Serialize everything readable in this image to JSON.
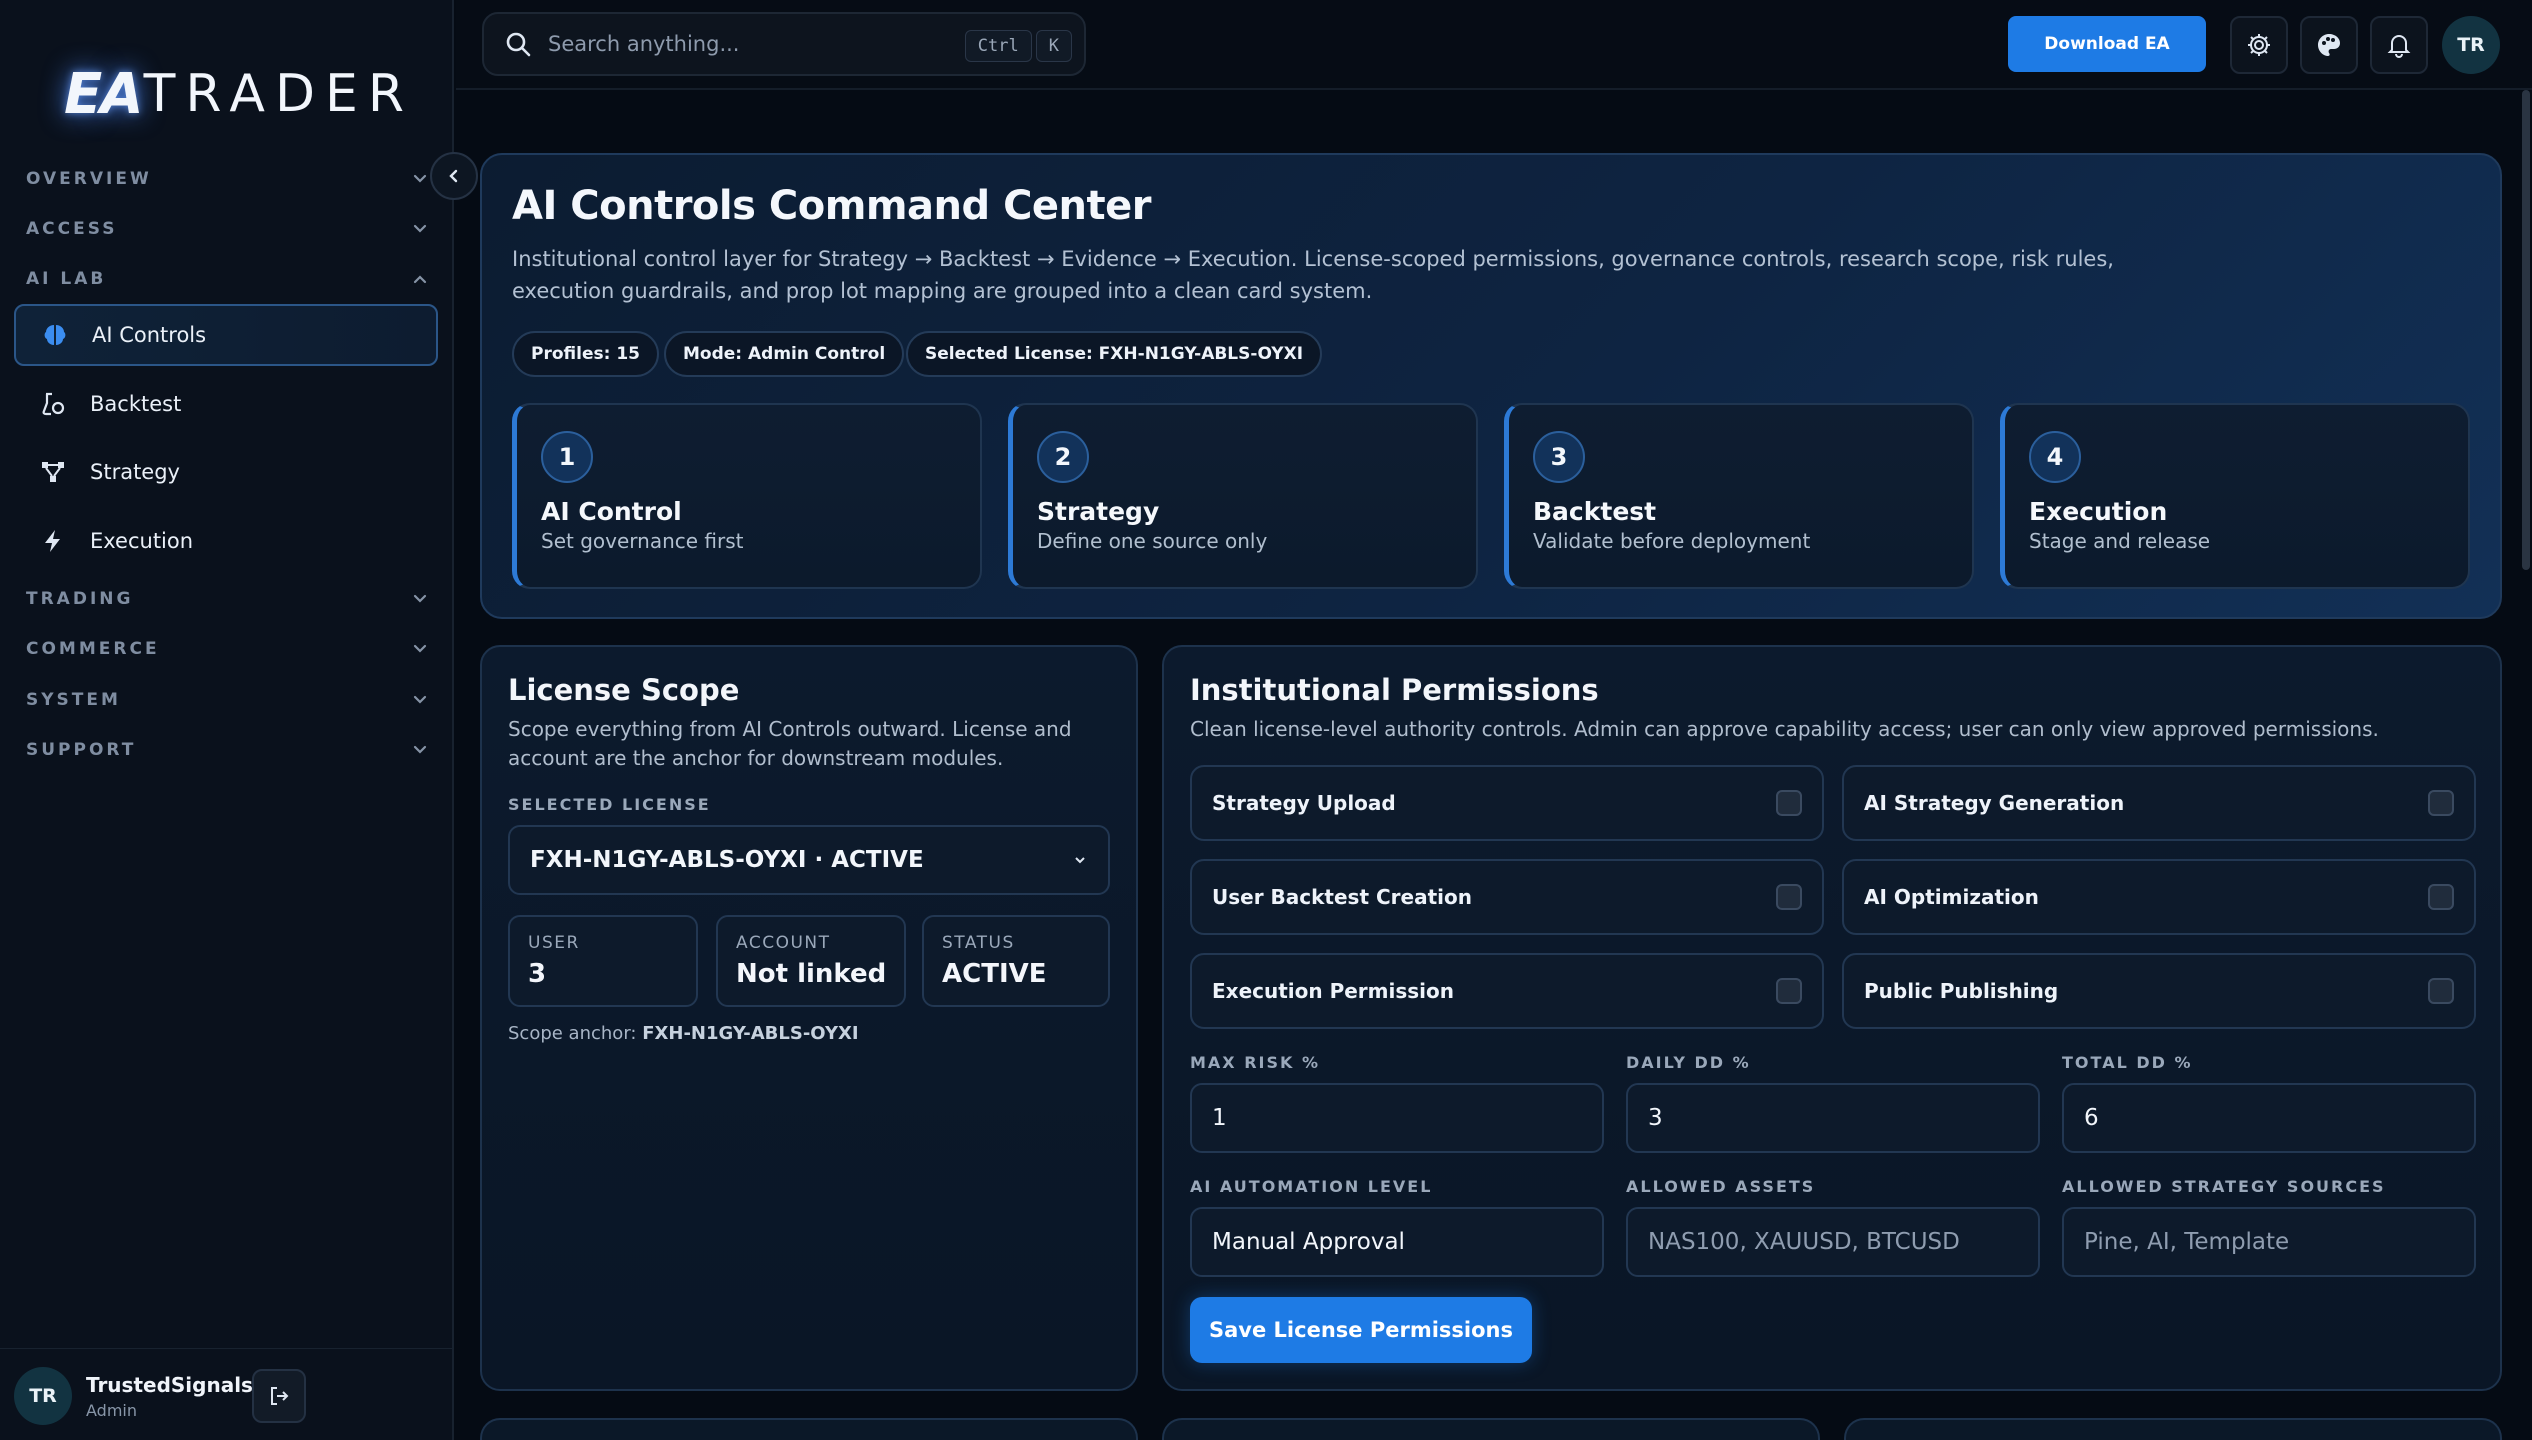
{
  "brand": {
    "logo_ea": "EA",
    "logo_trader": "TRADER"
  },
  "search": {
    "placeholder": "Search anything...",
    "shortcut_ctrl": "Ctrl",
    "shortcut_key": "K"
  },
  "topbar": {
    "download_label": "Download EA",
    "user_initials": "TR"
  },
  "sidebar": {
    "sections": [
      {
        "label": "OVERVIEW"
      },
      {
        "label": "ACCESS"
      },
      {
        "label": "AI LAB"
      },
      {
        "label": "TRADING"
      },
      {
        "label": "COMMERCE"
      },
      {
        "label": "SYSTEM"
      },
      {
        "label": "SUPPORT"
      }
    ],
    "items": [
      {
        "label": "AI Controls",
        "icon": "brain-icon",
        "active": true
      },
      {
        "label": "Backtest",
        "icon": "flask-icon"
      },
      {
        "label": "Strategy",
        "icon": "nodes-icon"
      },
      {
        "label": "Execution",
        "icon": "bolt-icon"
      }
    ],
    "user": {
      "initials": "TR",
      "name": "TrustedSignals",
      "role": "Admin"
    }
  },
  "hero": {
    "title": "AI Controls Command Center",
    "description": "Institutional control layer for Strategy → Backtest → Evidence → Execution. License-scoped permissions, governance controls, research scope, risk rules, execution guardrails, and prop lot mapping are grouped into a clean card system.",
    "chips": [
      "Profiles: 15",
      "Mode: Admin Control",
      "Selected License: FXH-N1GY-ABLS-OYXI"
    ],
    "steps": [
      {
        "num": "1",
        "title": "AI Control",
        "sub": "Set governance first"
      },
      {
        "num": "2",
        "title": "Strategy",
        "sub": "Define one source only"
      },
      {
        "num": "3",
        "title": "Backtest",
        "sub": "Validate before deployment"
      },
      {
        "num": "4",
        "title": "Execution",
        "sub": "Stage and release"
      }
    ]
  },
  "license_scope": {
    "title": "License Scope",
    "description": "Scope everything from AI Controls outward. License and account are the anchor for downstream modules.",
    "selected_label": "SELECTED LICENSE",
    "selected_value": "FXH-N1GY-ABLS-OYXI · ACTIVE",
    "stats": [
      {
        "key": "USER",
        "value": "3"
      },
      {
        "key": "ACCOUNT",
        "value": "Not linked"
      },
      {
        "key": "STATUS",
        "value": "ACTIVE"
      }
    ],
    "anchor_label": "Scope anchor:",
    "anchor_value": "FXH-N1GY-ABLS-OYXI"
  },
  "permissions": {
    "title": "Institutional Permissions",
    "description": "Clean license-level authority controls. Admin can approve capability access; user can only view approved permissions.",
    "toggles": [
      {
        "label": "Strategy Upload",
        "checked": false
      },
      {
        "label": "AI Strategy Generation",
        "checked": false
      },
      {
        "label": "User Backtest Creation",
        "checked": false
      },
      {
        "label": "AI Optimization",
        "checked": false
      },
      {
        "label": "Execution Permission",
        "checked": false
      },
      {
        "label": "Public Publishing",
        "checked": false
      }
    ],
    "fields": [
      {
        "label": "MAX RISK %",
        "value": "1"
      },
      {
        "label": "DAILY DD %",
        "value": "3"
      },
      {
        "label": "TOTAL DD %",
        "value": "6"
      },
      {
        "label": "AI AUTOMATION LEVEL",
        "value": "Manual Approval"
      },
      {
        "label": "ALLOWED ASSETS",
        "placeholder": "NAS100, XAUUSD, BTCUSD"
      },
      {
        "label": "ALLOWED STRATEGY SOURCES",
        "placeholder": "Pine, AI, Template"
      }
    ],
    "save_label": "Save License Permissions"
  },
  "colors": {
    "accent": "#1e7be5",
    "background": "#050b14",
    "panel": "#0c1a2d"
  }
}
